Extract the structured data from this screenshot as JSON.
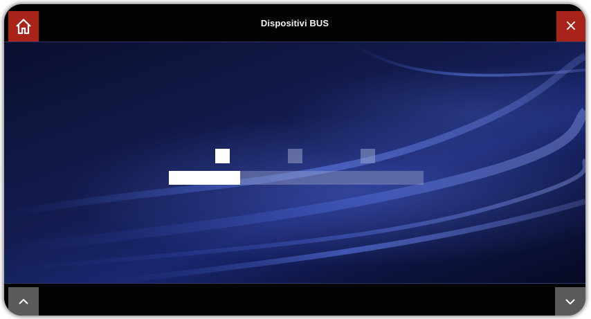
{
  "window": {
    "title": "Dispositivi BUS"
  },
  "header": {
    "home_icon": "home-icon",
    "close_icon": "close-icon",
    "close_glyph": "×",
    "accent_color": "#a8231a"
  },
  "loader": {
    "dots_active_index": 0,
    "dots_count": 3,
    "progress": 0.28
  },
  "footer": {
    "scroll_up_icon": "chevron-up-icon",
    "scroll_down_icon": "chevron-down-icon",
    "button_color": "#5a5a5a"
  }
}
